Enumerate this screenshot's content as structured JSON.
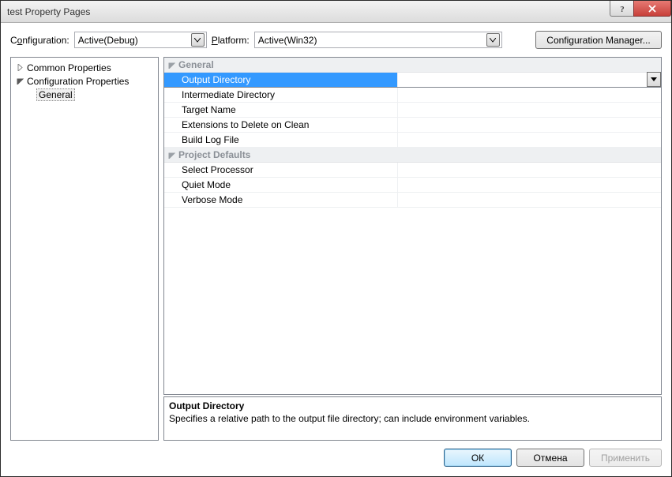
{
  "window": {
    "title": "test Property Pages"
  },
  "toolbar": {
    "config_label_pre": "C",
    "config_label_u": "o",
    "config_label_post": "nfiguration:",
    "config_value": "Active(Debug)",
    "platform_label_pre": "",
    "platform_label_u": "P",
    "platform_label_post": "latform:",
    "platform_value": "Active(Win32)",
    "cm_label": "Configuration Manager..."
  },
  "tree": {
    "n0": {
      "label": "Common Properties",
      "expanded": false
    },
    "n1": {
      "label": "Configuration Properties",
      "expanded": true,
      "c0": {
        "label": "General",
        "selected": true
      }
    }
  },
  "propgrid": {
    "cat0": {
      "label": "General",
      "p0": {
        "name": "Output Directory",
        "value": "",
        "selected": true
      },
      "p1": {
        "name": "Intermediate Directory",
        "value": ""
      },
      "p2": {
        "name": "Target Name",
        "value": ""
      },
      "p3": {
        "name": "Extensions to Delete on Clean",
        "value": ""
      },
      "p4": {
        "name": "Build Log File",
        "value": ""
      }
    },
    "cat1": {
      "label": "Project Defaults",
      "p0": {
        "name": "Select Processor",
        "value": ""
      },
      "p1": {
        "name": "Quiet Mode",
        "value": ""
      },
      "p2": {
        "name": "Verbose Mode",
        "value": ""
      }
    }
  },
  "desc": {
    "title": "Output Directory",
    "text": "Specifies a relative path to the output file directory; can include environment variables."
  },
  "footer": {
    "ok": "ОК",
    "cancel": "Отмена",
    "apply": "Применить"
  }
}
